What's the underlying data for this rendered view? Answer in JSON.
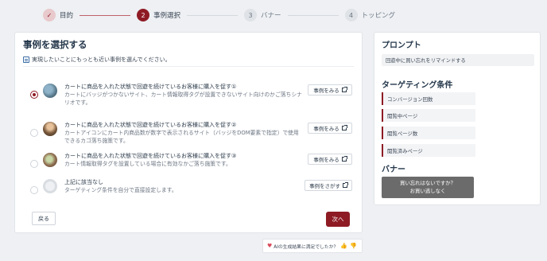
{
  "stepper": {
    "steps": [
      {
        "number": "✓",
        "label": "目的"
      },
      {
        "number": "2",
        "label": "事例選択"
      },
      {
        "number": "3",
        "label": "バナー"
      },
      {
        "number": "4",
        "label": "トッピング"
      }
    ]
  },
  "main": {
    "title": "事例を選択する",
    "instruction": "実現したいことにもっとも近い事例を選んでください。",
    "cases": [
      {
        "title": "カートに商品を入れた状態で回遊を続けているお客様に購入を促す①",
        "desc": "カートにバッジがつかないサイト、カート情報取得タグが設置できないサイト向けのかご落ちシナリオです。",
        "button": "事例をみる",
        "selected": true
      },
      {
        "title": "カートに商品を入れた状態で回遊を続けているお客様に購入を促す②",
        "desc": "カートアイコンにカート内商品数が数字で表示されるサイト（バッジをDOM要素で指定）で使用できるカゴ落ち施策です。",
        "button": "事例をみる",
        "selected": false
      },
      {
        "title": "カートに商品を入れた状態で回遊を続けているお客様に購入を促す③",
        "desc": "カート情報取得タグを設置している場合に有効なかご落ち施策です。",
        "button": "事例をみる",
        "selected": false
      },
      {
        "title": "上記に該当なし",
        "desc": "ターゲティング条件を自分で直接設定します。",
        "button": "事例をさがす",
        "selected": false
      }
    ],
    "back_label": "戻る",
    "next_label": "次へ"
  },
  "feedback": {
    "text": "AIの生成結果に満足でしたか？"
  },
  "side": {
    "prompt_heading": "プロンプト",
    "prompt_text": "回遊中に買い忘れをリマインドする",
    "targeting_heading": "ターゲティング条件",
    "conditions": [
      "コンバージョン回数",
      "閲覧中ページ",
      "閲覧ページ数",
      "閲覧済みページ"
    ],
    "banner_heading": "バナー",
    "banner_line1": "買い忘れはないですか？",
    "banner_line2": "お買い逃しなく"
  },
  "colors": {
    "accent": "#8e1b24",
    "background": "#eef0f3"
  }
}
